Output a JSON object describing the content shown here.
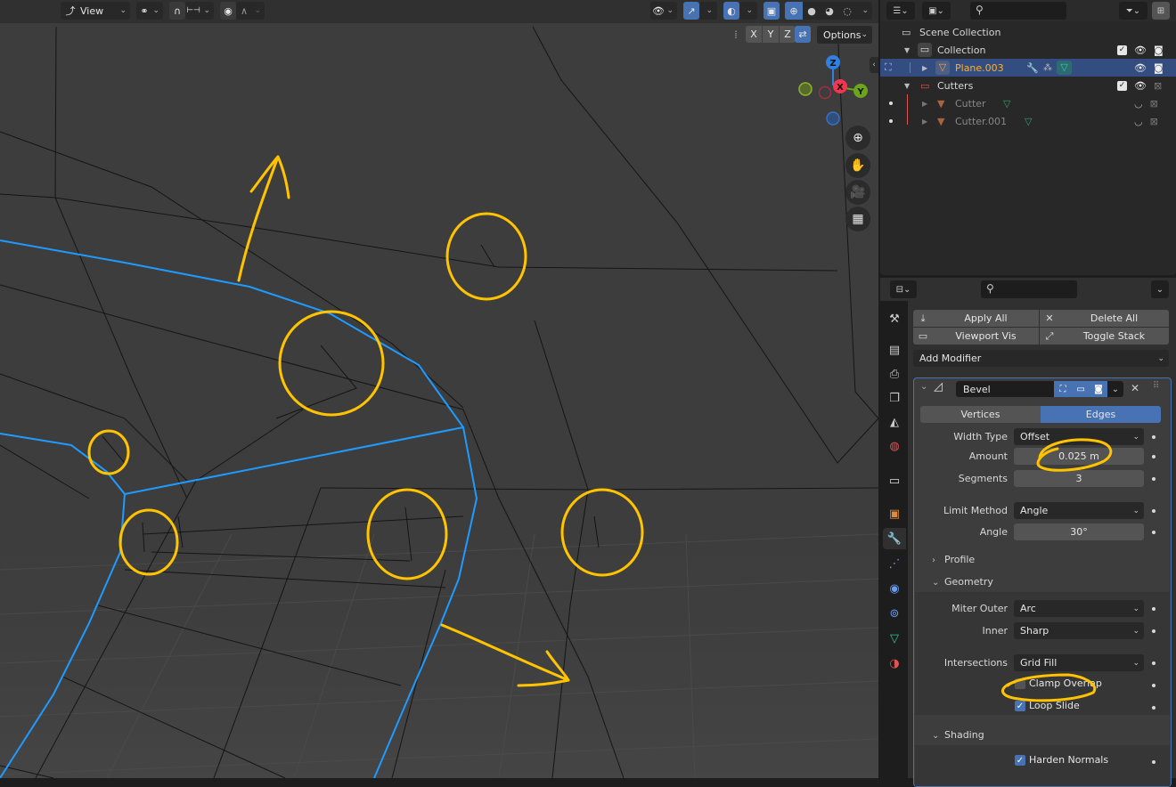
{
  "viewport": {
    "header": {
      "orientation_icon": "transform-orientation-icon",
      "view_label": "View",
      "pivot_icon": "pivot-point-icon",
      "snap_icon": "snap-magnet-icon",
      "snap_target_icon": "snap-increment-icon",
      "proportional_icon": "proportional-editing-icon",
      "falloff_icon": "falloff-curve-icon",
      "visibility_icon": "selectability-visibility-icon",
      "gizmo_icon": "gizmo-icon",
      "overlay_icon": "overlay-icon",
      "xray_icon": "xray-toggle-icon",
      "shading_modes": [
        "wireframe",
        "solid",
        "material-preview",
        "rendered"
      ],
      "active_shading": "wireframe"
    },
    "subheader": {
      "mirror_icon": "mirror-axis-icon",
      "axes": [
        "X",
        "Y",
        "Z"
      ],
      "auto_merge_icon": "auto-merge-icon",
      "options_label": "Options"
    },
    "gizmo": {
      "axes": [
        {
          "label": "Z",
          "color": "#2f80e1"
        },
        {
          "label": "X",
          "color": "#f3364f"
        },
        {
          "label": "Y",
          "color": "#6aa51a"
        }
      ]
    },
    "nav_buttons": [
      "zoom-icon",
      "pan-hand-icon",
      "camera-icon",
      "perspective-grid-icon"
    ],
    "colors": {
      "background": "#3d3d3d",
      "selected_edge": "#1f9bff",
      "wire": "#141414",
      "annotation": "#ffc300"
    }
  },
  "outliner": {
    "header": {
      "display_mode_icon": "outliner-display-mode-icon",
      "filter_icon": "filter-icon",
      "new_collection_icon": "new-collection-icon",
      "search_placeholder": ""
    },
    "rows": [
      {
        "label": "Scene Collection",
        "type": "scene-collection"
      },
      {
        "label": "Collection",
        "type": "collection",
        "checked": true
      },
      {
        "label": "Plane.003",
        "type": "mesh-object",
        "selected": true
      },
      {
        "label": "Cutters",
        "type": "collection",
        "checked": true,
        "color": "#e05454"
      },
      {
        "label": "Cutter",
        "type": "mesh-object",
        "hidden": true
      },
      {
        "label": "Cutter.001",
        "type": "mesh-object",
        "hidden": true
      }
    ],
    "active_color": "#ffaf29"
  },
  "properties": {
    "header": {
      "editor_icon": "properties-editor-icon",
      "search_placeholder": ""
    },
    "tabs": [
      "tool-icon",
      "render-icon",
      "output-icon",
      "view-layer-icon",
      "scene-icon",
      "world-icon",
      "collection-icon",
      "object-icon",
      "modifier-wrench-icon",
      "particles-icon",
      "physics-icon",
      "constraints-icon",
      "object-data-icon",
      "material-icon"
    ],
    "active_tab": "modifier-wrench-icon",
    "toolbar": {
      "apply_all": "Apply All",
      "delete_all": "Delete All",
      "viewport_vis": "Viewport Vis",
      "toggle_stack": "Toggle Stack",
      "add_modifier": "Add Modifier"
    },
    "modifier": {
      "name": "Bevel",
      "affect_options": [
        "Vertices",
        "Edges"
      ],
      "affect_selected": "Edges",
      "width_type_label": "Width Type",
      "width_type_value": "Offset",
      "amount_label": "Amount",
      "amount_value": "0.025 m",
      "segments_label": "Segments",
      "segments_value": "3",
      "limit_method_label": "Limit Method",
      "limit_method_value": "Angle",
      "angle_label": "Angle",
      "angle_value": "30°",
      "profile_label": "Profile",
      "geometry_label": "Geometry",
      "miter_outer_label": "Miter Outer",
      "miter_outer_value": "Arc",
      "inner_label": "Inner",
      "inner_value": "Sharp",
      "intersections_label": "Intersections",
      "intersections_value": "Grid Fill",
      "clamp_overlap_label": "Clamp Overlap",
      "clamp_overlap": false,
      "loop_slide_label": "Loop Slide",
      "loop_slide": true,
      "shading_label": "Shading",
      "harden_normals_label": "Harden Normals",
      "harden_normals": true
    }
  }
}
